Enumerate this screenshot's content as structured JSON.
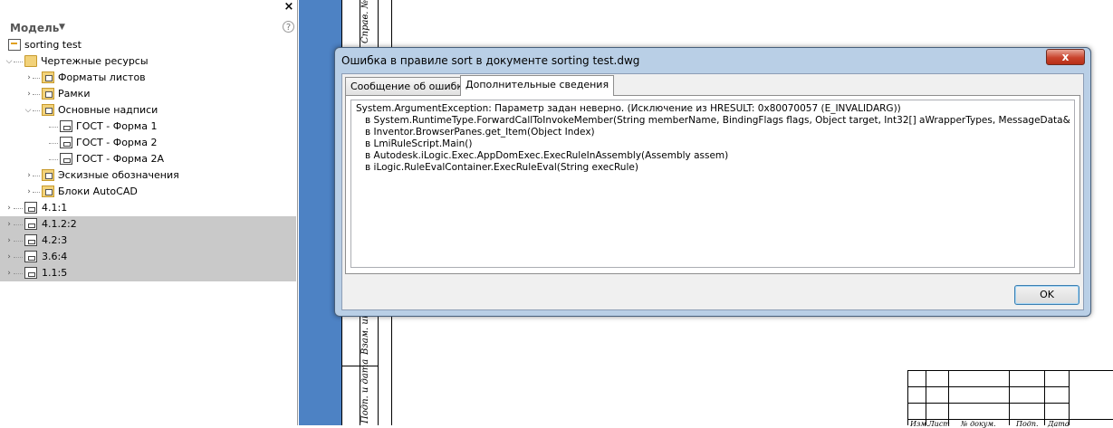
{
  "browser": {
    "title": "Модель",
    "tree": [
      {
        "label": "sorting test",
        "icon": "drawing-document-icon"
      },
      {
        "label": "Чертежные ресурсы",
        "icon": "folder-icon"
      },
      {
        "label": "Форматы листов",
        "icon": "folder-icon"
      },
      {
        "label": "Рамки",
        "icon": "folder-icon"
      },
      {
        "label": "Основные надписи",
        "icon": "folder-icon"
      },
      {
        "label": "ГОСТ - Форма 1",
        "icon": "title-block-icon"
      },
      {
        "label": "ГОСТ - Форма 2",
        "icon": "title-block-icon"
      },
      {
        "label": "ГОСТ - Форма 2А",
        "icon": "title-block-icon"
      },
      {
        "label": "Эскизные обозначения",
        "icon": "folder-icon"
      },
      {
        "label": "Блоки AutoCAD",
        "icon": "folder-icon"
      },
      {
        "label": "4.1:1",
        "icon": "sheet-icon"
      },
      {
        "label": "4.1.2:2",
        "icon": "sheet-icon"
      },
      {
        "label": "4.2:3",
        "icon": "sheet-icon"
      },
      {
        "label": "3.6:4",
        "icon": "sheet-icon"
      },
      {
        "label": "1.1:5",
        "icon": "sheet-icon"
      }
    ]
  },
  "drawing": {
    "frame_labels": [
      "Справ. №",
      "Взам. инв. №",
      "Подп. и дата"
    ],
    "title_block_labels": [
      "Изм.",
      "Лист",
      "№ докум.",
      "Подп.",
      "Дата"
    ]
  },
  "dialog": {
    "title": "Ошибка в правиле sort в документе sorting test.dwg",
    "close_glyph": "x",
    "tabs": [
      "Сообщение об ошибке",
      "Дополнительные сведения"
    ],
    "active_tab": 1,
    "details_lines": [
      "System.ArgumentException: Параметр задан неверно. (Исключение из HRESULT: 0x80070057 (E_INVALIDARG))",
      "   в System.RuntimeType.ForwardCallToInvokeMember(String memberName, BindingFlags flags, Object target, Int32[] aWrapperTypes, MessageData& msgData)",
      "   в Inventor.BrowserPanes.get_Item(Object Index)",
      "   в LmiRuleScript.Main()",
      "   в Autodesk.iLogic.Exec.AppDomExec.ExecRuleInAssembly(Assembly assem)",
      "   в iLogic.RuleEvalContainer.ExecRuleEval(String execRule)"
    ],
    "ok_label": "OK"
  }
}
